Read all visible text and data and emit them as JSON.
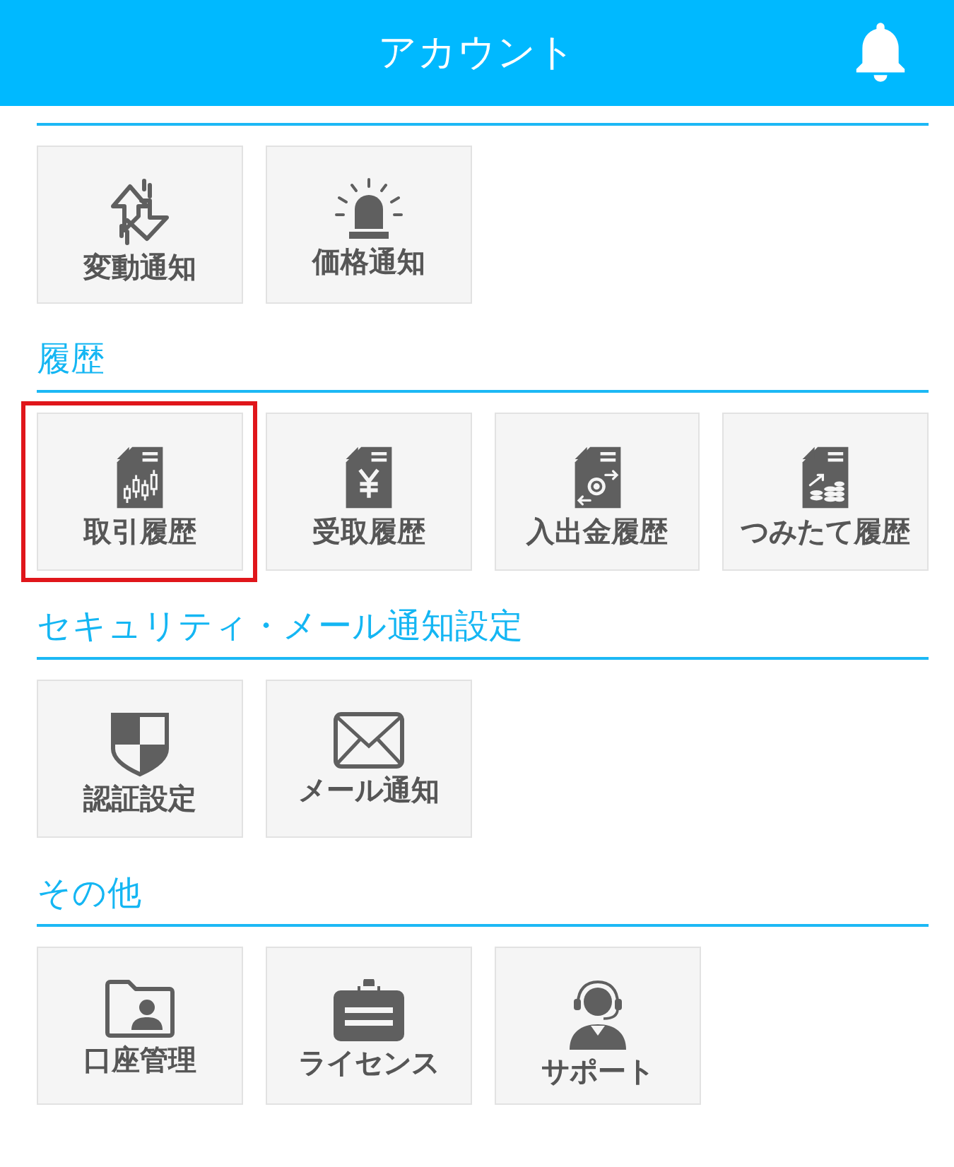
{
  "header": {
    "title": "アカウント"
  },
  "sections": [
    {
      "items": [
        {
          "kind": "fluctuation",
          "label": "変動通知",
          "highlighted": false
        },
        {
          "kind": "siren",
          "label": "価格通知",
          "highlighted": false
        }
      ]
    },
    {
      "title": "履歴",
      "items": [
        {
          "kind": "trade",
          "label": "取引履歴",
          "highlighted": true
        },
        {
          "kind": "receipt",
          "label": "受取履歴",
          "highlighted": false
        },
        {
          "kind": "deposit",
          "label": "入出金履歴",
          "highlighted": false
        },
        {
          "kind": "savings",
          "label": "つみたて履歴",
          "highlighted": false
        }
      ]
    },
    {
      "title": "セキュリティ・メール通知設定",
      "items": [
        {
          "kind": "auth",
          "label": "認証設定",
          "highlighted": false
        },
        {
          "kind": "mail",
          "label": "メール通知",
          "highlighted": false
        }
      ]
    },
    {
      "title": "その他",
      "items": [
        {
          "kind": "account",
          "label": "口座管理",
          "highlighted": false
        },
        {
          "kind": "license",
          "label": "ライセンス",
          "highlighted": false
        },
        {
          "kind": "support",
          "label": "サポート",
          "highlighted": false
        }
      ]
    }
  ]
}
